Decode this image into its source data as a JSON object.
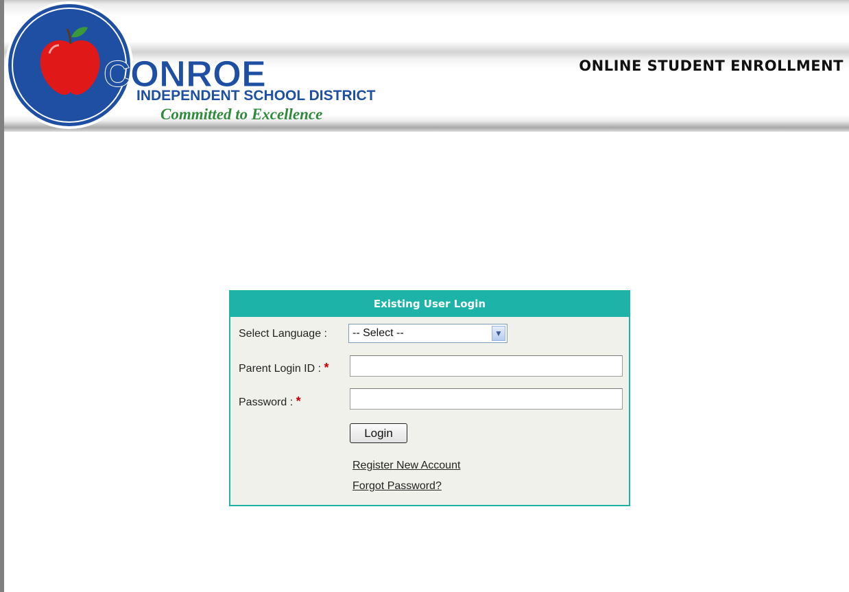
{
  "header": {
    "logo_name": "CONROE",
    "logo_subtitle": "INDEPENDENT SCHOOL DISTRICT",
    "logo_tagline": "Committed to Excellence",
    "title": "ONLINE STUDENT ENROLLMENT"
  },
  "login": {
    "heading": "Existing User Login",
    "language_label": "Select Language :",
    "language_selected": "-- Select --",
    "login_id_label": "Parent Login ID :",
    "login_id_value": "",
    "password_label": "Password :",
    "password_value": "",
    "required_marker": "*",
    "login_button": "Login",
    "register_link": "Register New Account",
    "forgot_link": "Forgot Password?"
  },
  "colors": {
    "accent": "#1db3a8",
    "brand_blue": "#1f4fa3",
    "brand_green": "#2f8a3e",
    "apple_red": "#e01818",
    "required": "#cc0000"
  },
  "icons": {
    "select_arrow": "chevron-down-icon",
    "logo": "apple-icon"
  }
}
